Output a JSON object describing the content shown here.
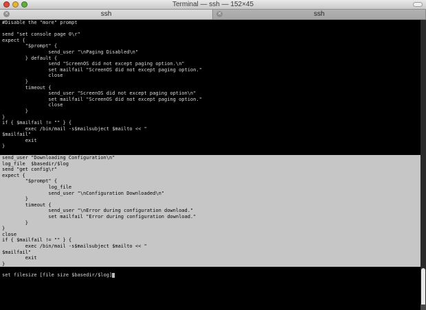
{
  "window": {
    "title": "Terminal — ssh — 152×45"
  },
  "tabs": [
    {
      "label": "ssh",
      "active": true
    },
    {
      "label": "ssh",
      "active": false
    }
  ],
  "terminal": {
    "lines_before": [
      "#Disable the \"more\" prompt",
      "",
      "send \"set console page 0\\r\"",
      "expect {",
      "        \"$prompt\" {",
      "                send_user \"\\nPaging Disabled\\n\"",
      "        } default {",
      "                send \"ScreenOS did not except paging option.\\n\"",
      "                set mailfail \"ScreenOS did not except paging option.\"",
      "                close",
      "        }",
      "        timeout {",
      "                send_user \"ScreenOS did not except paging option\\n\"",
      "                set mailfail \"ScreenOS did not except paging option.\"",
      "                close",
      "        }",
      "}",
      "if { $mailfail != \"\" } {",
      "        exec /bin/mail -s$mailsubject $mailto << \"",
      "$mailfail\"",
      "        exit",
      "}"
    ],
    "lines_selected": [
      "send_user \"Downloading Configuration\\n\"",
      "log_file  $basedir/$log",
      "send \"get config\\r\"",
      "expect {",
      "        \"$prompt\" {",
      "                log_file",
      "                send_user \"\\nConfiguration Downloaded\\n\"",
      "        }",
      "        timeout {",
      "                send_user \"\\nError during configuration download.\"",
      "                set mailfail \"Error during configuration download.\"",
      "        }",
      "}",
      "close",
      "if { $mailfail != \"\" } {",
      "        exec /bin/mail -s$mailsubject $mailto << \"",
      "$mailfail\"",
      "        exit",
      "}"
    ],
    "prompt_line": "set filesize [file size $basedir/$log]"
  }
}
